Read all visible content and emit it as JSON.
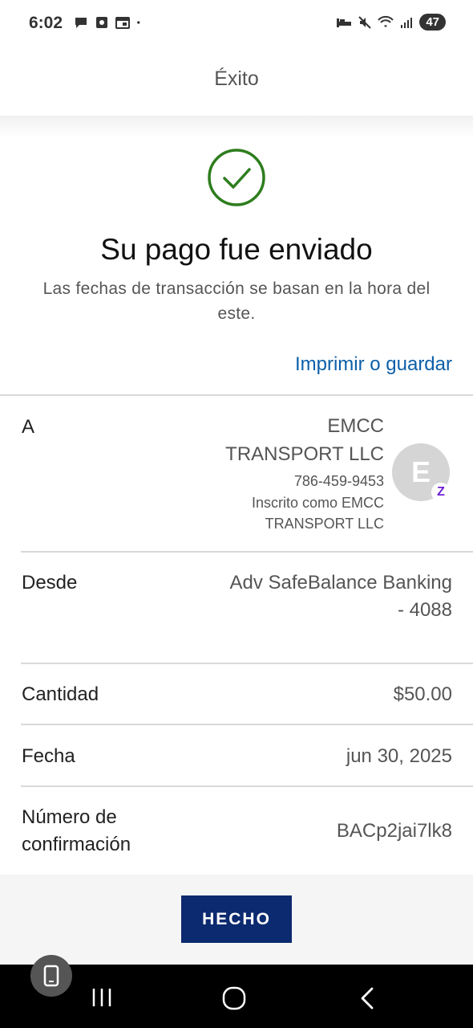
{
  "status_bar": {
    "time": "6:02",
    "battery": "47"
  },
  "header": {
    "title": "Éxito"
  },
  "success": {
    "title": "Su pago fue enviado",
    "subtitle": "Las fechas de transacción se basan en la hora del este.",
    "print_link": "Imprimir o guardar",
    "check_color": "#2e7d1e"
  },
  "details": {
    "to": {
      "label": "A",
      "name_line1": "EMCC",
      "name_line2": "TRANSPORT LLC",
      "phone": "786-459-9453",
      "enrolled_line1": "Inscrito como EMCC",
      "enrolled_line2": "TRANSPORT LLC",
      "avatar_letter": "E",
      "badge_letter": "Z"
    },
    "from": {
      "label": "Desde",
      "value_line1": "Adv SafeBalance Banking",
      "value_line2": "- 4088"
    },
    "amount": {
      "label": "Cantidad",
      "value": "$50.00"
    },
    "date": {
      "label": "Fecha",
      "value": "jun 30, 2025"
    },
    "confirmation": {
      "label_line1": "Número de",
      "label_line2": "confirmación",
      "value": "BACp2jai7lk8"
    }
  },
  "footer": {
    "done_label": "HECHO",
    "button_color": "#0b2a6f"
  },
  "nav": {
    "icons": [
      "recents-icon",
      "home-icon",
      "back-icon"
    ]
  }
}
